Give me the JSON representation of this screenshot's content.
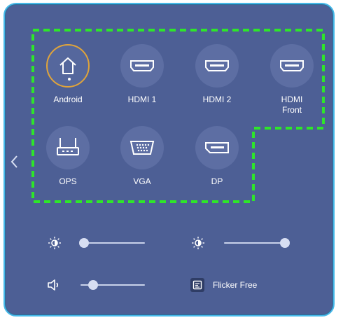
{
  "sources": [
    {
      "label": "Android",
      "icon": "home-icon",
      "active": true
    },
    {
      "label": "HDMI 1",
      "icon": "hdmi-port-icon",
      "active": false
    },
    {
      "label": "HDMI 2",
      "icon": "hdmi-port-icon",
      "active": false
    },
    {
      "label": "HDMI",
      "sublabel": "Front",
      "icon": "hdmi-port-icon",
      "active": false
    },
    {
      "label": "OPS",
      "icon": "ops-router-icon",
      "active": false
    },
    {
      "label": "VGA",
      "icon": "vga-port-icon",
      "active": false
    },
    {
      "label": "DP",
      "icon": "displayport-icon",
      "active": false
    }
  ],
  "controls": {
    "brightness": {
      "icon": "brightness-low-icon",
      "value": 0.05
    },
    "contrast": {
      "icon": "brightness-high-icon",
      "value": 1.0
    },
    "volume": {
      "icon": "volume-icon",
      "value": 0.2
    },
    "flicker_free": {
      "icon": "flicker-free-icon",
      "label": "Flicker Free"
    }
  },
  "colors": {
    "panel": "#4d5f95",
    "panel_border": "#45b8e8",
    "highlight_dash": "#2ee62a",
    "active_ring": "#e0a43a"
  }
}
